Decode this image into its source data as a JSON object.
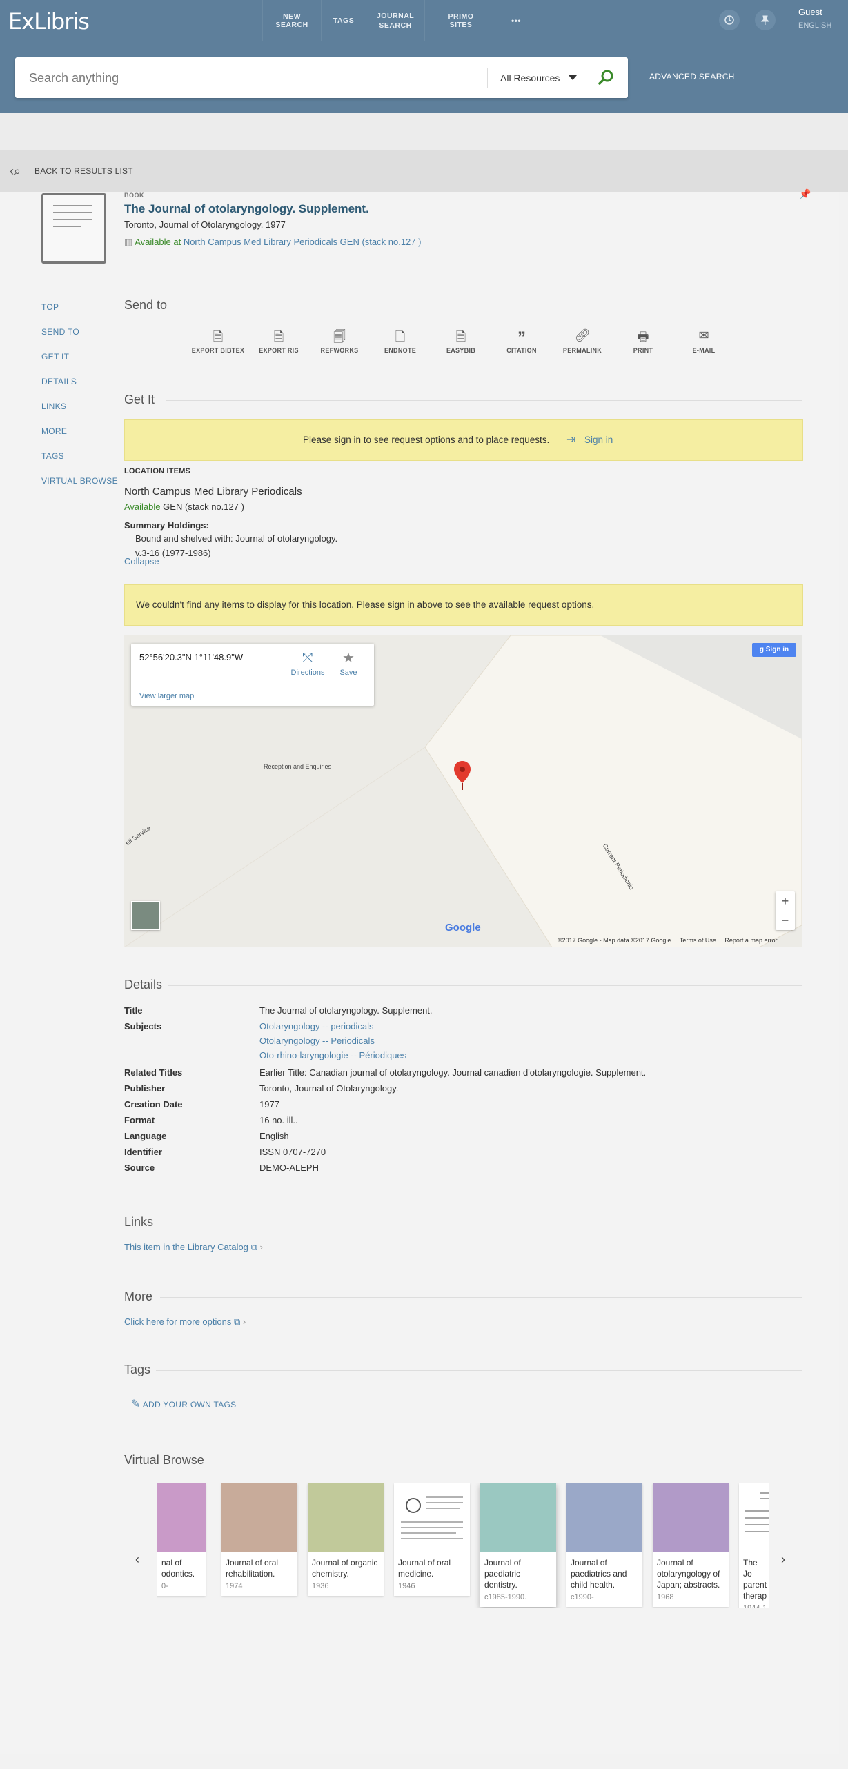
{
  "header": {
    "logo": "ExLibris",
    "nav": [
      "NEW SEARCH",
      "TAGS",
      "JOURNAL SEARCH",
      "PRIMO SITES",
      "•••"
    ],
    "user": "Guest",
    "language": "ENGLISH",
    "search_placeholder": "Search anything",
    "scope": "All Resources",
    "advanced": "ADVANCED SEARCH"
  },
  "back": "BACK TO RESULTS LIST",
  "record": {
    "type": "BOOK",
    "title": "The Journal of otolaryngology. Supplement.",
    "subtitle": "Toronto, Journal of Otolaryngology. 1977",
    "available": "Available at",
    "location": "North Campus Med Library Periodicals  GEN (stack no.127 )"
  },
  "sidebar": [
    "TOP",
    "SEND TO",
    "GET IT",
    "DETAILS",
    "LINKS",
    "MORE",
    "TAGS",
    "VIRTUAL BROWSE"
  ],
  "send_to": {
    "heading": "Send to",
    "items": [
      {
        "label": "EXPORT BIBTEX",
        "icon": "file-export-icon"
      },
      {
        "label": "EXPORT RIS",
        "icon": "file-export-icon"
      },
      {
        "label": "REFWORKS",
        "icon": "file-text-icon"
      },
      {
        "label": "ENDNOTE",
        "icon": "file-icon"
      },
      {
        "label": "EASYBIB",
        "icon": "file-export-icon"
      },
      {
        "label": "CITATION",
        "icon": "quote-icon"
      },
      {
        "label": "PERMALINK",
        "icon": "link-icon"
      },
      {
        "label": "PRINT",
        "icon": "printer-icon"
      },
      {
        "label": "E-MAIL",
        "icon": "envelope-icon"
      }
    ]
  },
  "get_it": {
    "heading": "Get It",
    "signin_msg": "Please sign in to see request options and to place requests.",
    "signin": "Sign in",
    "location_items": "LOCATION ITEMS",
    "library": "North Campus Med Library Periodicals",
    "available": "Available",
    "shelf": "GEN (stack no.127 )",
    "summary_label": "Summary Holdings:",
    "summary_1": "Bound and shelved with: Journal of otolaryngology.",
    "summary_2": "v.3-16 (1977-1986)",
    "collapse": "Collapse",
    "no_items_msg": "We couldn't find any items to display for this location. Please sign in above to see the available request options."
  },
  "map": {
    "coords": "52°56'20.3\"N 1°11'48.9\"W",
    "directions": "Directions",
    "save": "Save",
    "larger": "View larger map",
    "sign_in": "Sign in",
    "label_reception": "Reception and Enquiries",
    "label_current": "Current Periodicals",
    "label_self": "elf Service",
    "brand": "Google",
    "footer": "©2017 Google - Map data ©2017 Google",
    "terms": "Terms of Use",
    "report": "Report a map error"
  },
  "details": {
    "heading": "Details",
    "rows": {
      "title_k": "Title",
      "title_v": "The Journal of otolaryngology. Supplement.",
      "subjects_k": "Subjects",
      "subj1": "Otolaryngology -- periodicals",
      "subj2": "Otolaryngology -- Periodicals",
      "subj3": "Oto-rhino-laryngologie -- Périodiques",
      "related_k": "Related Titles",
      "related_v": "Earlier Title: Canadian journal of otolaryngology. Journal canadien d'otolaryngologie. Supplement.",
      "publisher_k": "Publisher",
      "publisher_v": "Toronto, Journal of Otolaryngology.",
      "creation_k": "Creation Date",
      "creation_v": "1977",
      "format_k": "Format",
      "format_v": "16 no. ill..",
      "language_k": "Language",
      "language_v": "English",
      "identifier_k": "Identifier",
      "identifier_v": "ISSN 0707-7270",
      "source_k": "Source",
      "source_v": "DEMO-ALEPH"
    }
  },
  "links": {
    "heading": "Links",
    "catalog": "This item in the Library Catalog"
  },
  "more": {
    "heading": "More",
    "link": "Click here for more options"
  },
  "tags": {
    "heading": "Tags",
    "add": "ADD YOUR OWN TAGS"
  },
  "virtual_browse": {
    "heading": "Virtual Browse",
    "items": [
      {
        "title": "nal of odontics.",
        "year": "0-",
        "color": "#c99ac8"
      },
      {
        "title": "Journal of oral rehabilitation.",
        "year": "1974",
        "color": "#c8ab9a"
      },
      {
        "title": "Journal of organic chemistry.",
        "year": "1936",
        "color": "#c1c99a"
      },
      {
        "title": "Journal of oral medicine.",
        "year": "1946",
        "color": "#ffffff"
      },
      {
        "title": "Journal of paediatric dentistry.",
        "year": "c1985-1990.",
        "color": "#9ac8c1"
      },
      {
        "title": "Journal of paediatrics and child health.",
        "year": "c1990-",
        "color": "#9aa8c8"
      },
      {
        "title": "Journal of otolaryngology of Japan; abstracts.",
        "year": "1968",
        "color": "#b19ac8"
      },
      {
        "title": "The Jo parent therap",
        "year": "1944-1",
        "color": "#ffffff"
      }
    ]
  }
}
